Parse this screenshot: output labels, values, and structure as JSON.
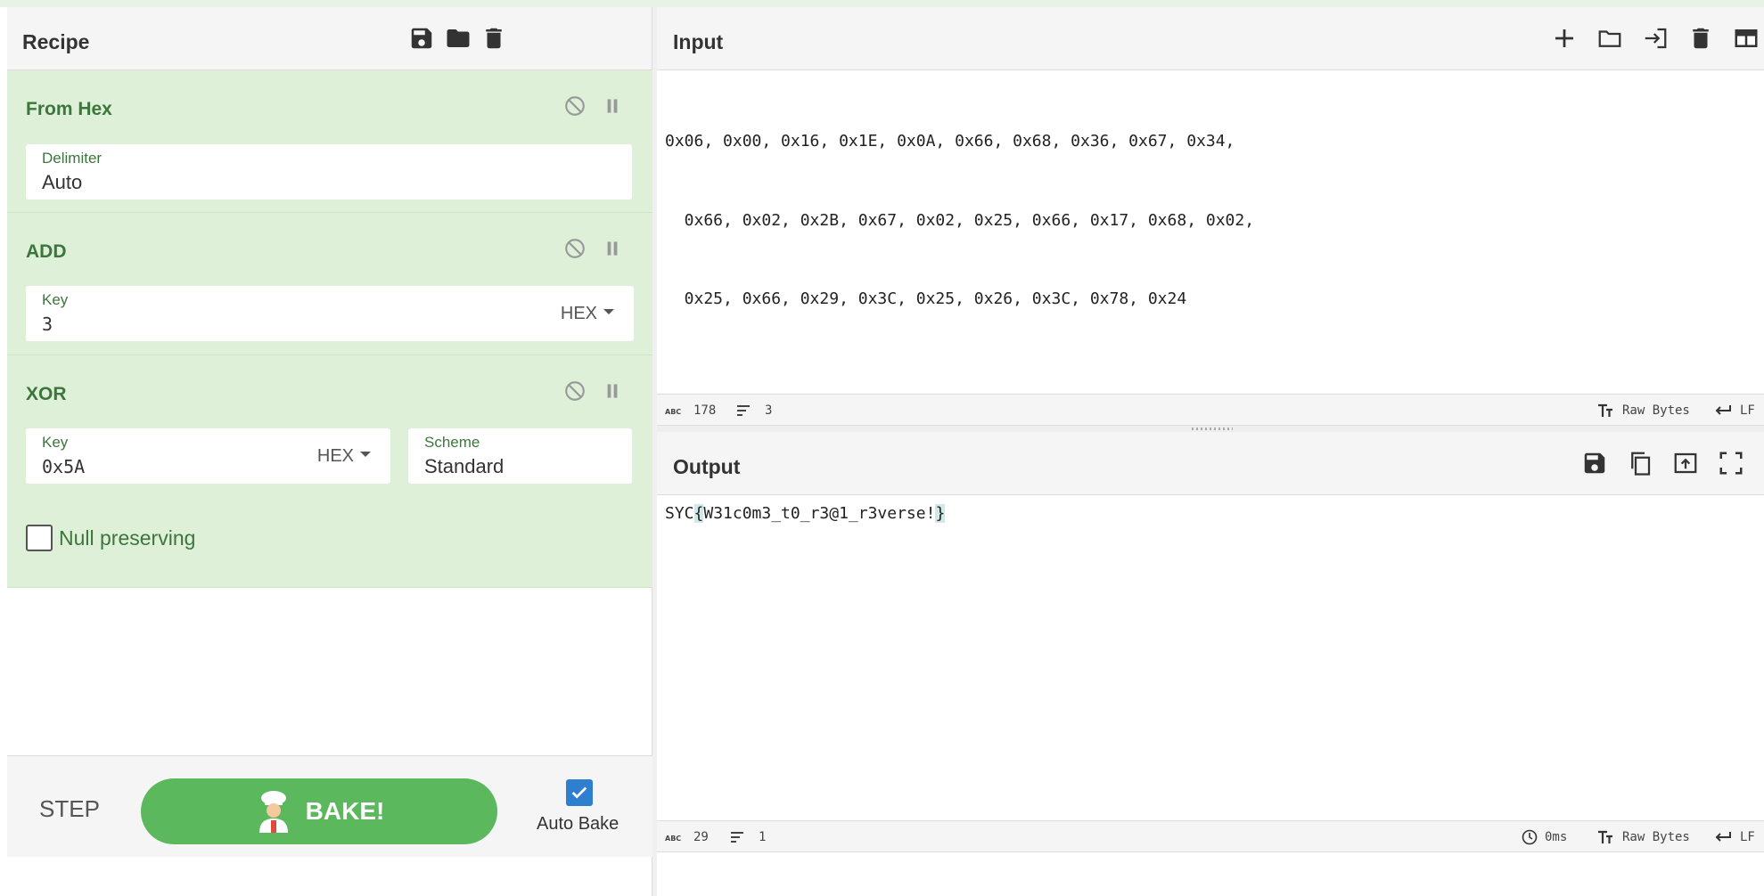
{
  "recipe": {
    "title": "Recipe",
    "operations": [
      {
        "name": "From Hex",
        "fields": [
          {
            "label": "Delimiter",
            "value": "Auto"
          }
        ]
      },
      {
        "name": "ADD",
        "fields": [
          {
            "label": "Key",
            "value": "3",
            "format": "HEX"
          }
        ]
      },
      {
        "name": "XOR",
        "fields": [
          {
            "label": "Key",
            "value": "0x5A",
            "format": "HEX"
          },
          {
            "label": "Scheme",
            "value": "Standard"
          }
        ],
        "checkbox_label": "Null preserving"
      }
    ],
    "controls": {
      "step_label": "STEP",
      "bake_label": "BAKE!",
      "autobake_label": "Auto Bake",
      "autobake_checked": true
    }
  },
  "input": {
    "title": "Input",
    "lines": [
      "0x06, 0x00, 0x16, 0x1E, 0x0A, 0x66, 0x68, 0x36, 0x67, 0x34, ",
      "  0x66, 0x02, 0x2B, 0x67, 0x02, 0x25, 0x66, 0x17, 0x68, 0x02,",
      "  0x25, 0x66, 0x29, 0x3C, 0x25, 0x26, 0x3C, 0x78, 0x24"
    ],
    "status": {
      "length": "178",
      "lines": "3",
      "encoding": "Raw Bytes",
      "eol": "LF"
    }
  },
  "output": {
    "title": "Output",
    "text_prefix": "SYC",
    "text_open": "{",
    "text_middle": "W31c0m3_t0_r3@1_r3verse!",
    "text_close": "}",
    "status": {
      "length": "29",
      "lines": "1",
      "time": "0ms",
      "encoding": "Raw Bytes",
      "eol": "LF"
    }
  },
  "colors": {
    "accent_green": "#5cb85c",
    "op_bg": "#dff0d8",
    "op_text": "#3c763d",
    "checkbox_blue": "#2f7fd0"
  },
  "icons": [
    "save-icon",
    "folder-icon",
    "trash-icon",
    "disable-icon",
    "pause-icon",
    "plus-icon",
    "import-icon",
    "layout-icon",
    "copy-icon",
    "replace-input-icon",
    "maximize-icon",
    "clock-icon",
    "text-size-icon",
    "return-icon",
    "lines-icon",
    "chef-icon",
    "check-icon"
  ]
}
